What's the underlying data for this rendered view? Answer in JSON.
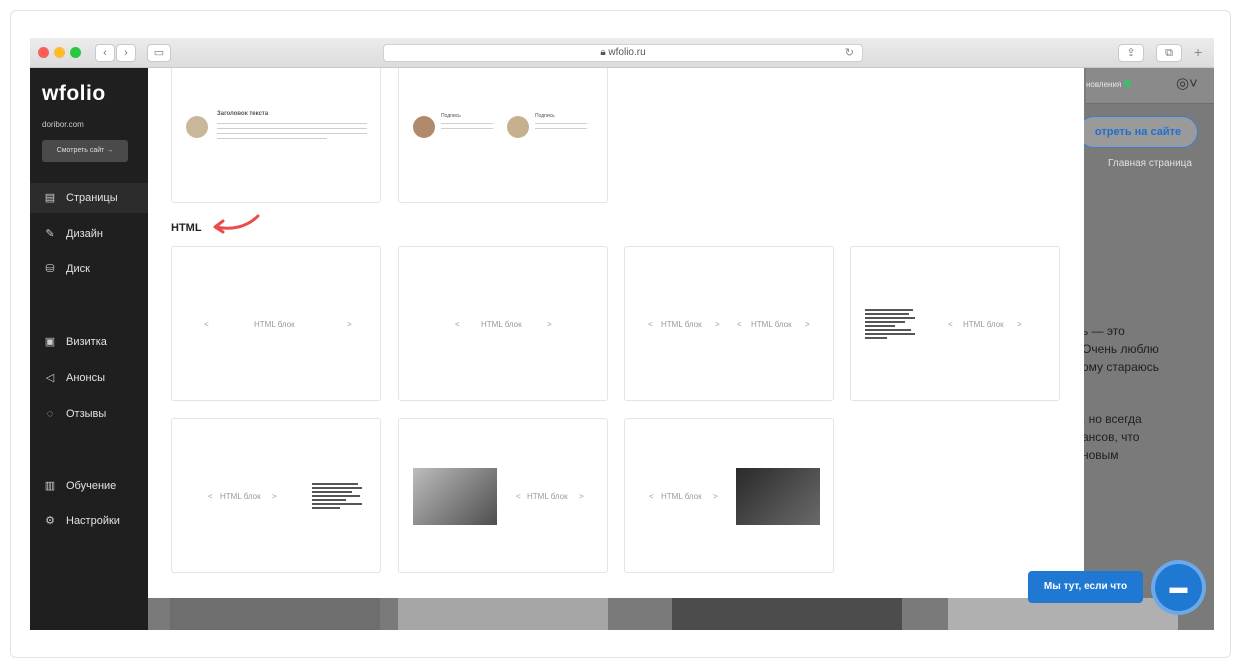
{
  "browser": {
    "url": "wfolio.ru",
    "back_icon": "chevron-left-icon",
    "forward_icon": "chevron-right-icon"
  },
  "sidebar": {
    "logo": "wfolio",
    "domain": "doribor.com",
    "view_site_button": "Смотреть сайт →",
    "items": [
      {
        "label": "Страницы",
        "icon": "page-icon",
        "active": true
      },
      {
        "label": "Дизайн",
        "icon": "brush-icon",
        "active": false
      },
      {
        "label": "Диск",
        "icon": "disk-icon",
        "active": false
      },
      {
        "label": "Визитка",
        "icon": "card-icon",
        "active": false
      },
      {
        "label": "Анонсы",
        "icon": "megaphone-icon",
        "active": false
      },
      {
        "label": "Отзывы",
        "icon": "chat-bubbles-icon",
        "active": false
      },
      {
        "label": "Обучение",
        "icon": "book-icon",
        "active": false
      },
      {
        "label": "Настройки",
        "icon": "gear-icon",
        "active": false
      }
    ]
  },
  "background_page": {
    "updates_label": "новления",
    "view_site_button": "отреть на сайте",
    "home_link": "Главная страница",
    "text_lines_1": [
      "ь — это",
      "Очень люблю",
      "ому стараюсь"
    ],
    "text_lines_2": [
      ", но всегда",
      "ансов, что",
      "новым"
    ]
  },
  "modal": {
    "section_title": "HTML",
    "top_cards": [
      {
        "heading": "Заголовок текста"
      },
      {
        "heading_left": "Подпись",
        "heading_right": "Подпись"
      }
    ],
    "html_block_label": "HTML блок",
    "html_cards": [
      {
        "labels": [
          "HTML блок"
        ]
      },
      {
        "labels": [
          "HTML блок"
        ]
      },
      {
        "labels": [
          "HTML блок",
          "HTML блок"
        ]
      },
      {
        "labels": [
          "HTML блок"
        ],
        "text_left": true
      },
      {
        "labels": [
          "HTML блок"
        ],
        "text_right": true
      },
      {
        "labels": [
          "HTML блок"
        ],
        "photo_left": true
      },
      {
        "labels": [
          "HTML блок"
        ],
        "photo_right": true
      }
    ]
  },
  "chat": {
    "label": "Мы тут, если что",
    "icon": "chat-icon"
  },
  "colors": {
    "accent": "#1f78d1",
    "sidebar_bg": "#1f1f1f",
    "arrow": "#e84c4c"
  }
}
